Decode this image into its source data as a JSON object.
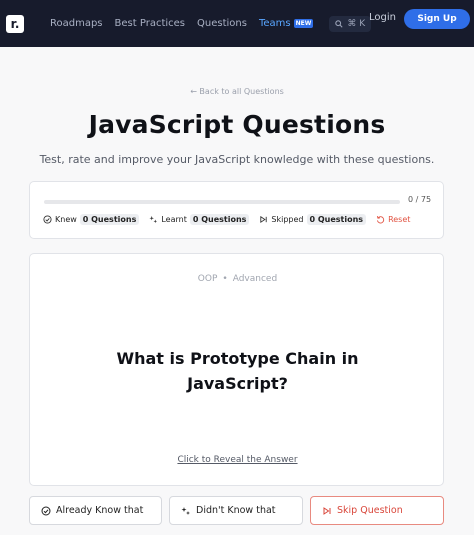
{
  "nav": {
    "logo_letter": "r.",
    "links": [
      "Roadmaps",
      "Best Practices",
      "Questions"
    ],
    "teams_label": "Teams",
    "teams_badge": "NEW",
    "search_shortcut": "⌘ K",
    "login_label": "Login",
    "signup_label": "Sign Up",
    "accent_color": "#2f6ee8"
  },
  "main": {
    "back_link": "← Back to all Questions",
    "title": "JavaScript Questions",
    "subtitle": "Test, rate and improve your JavaScript knowledge with these questions."
  },
  "progress": {
    "fraction": 0,
    "count_text": "0 / 75",
    "knew_label": "Knew",
    "knew_count": "0 Questions",
    "learnt_label": "Learnt",
    "learnt_count": "0 Questions",
    "skipped_label": "Skipped",
    "skipped_count": "0 Questions",
    "reset_label": "Reset"
  },
  "question": {
    "category": "OOP",
    "level": "Advanced",
    "separator": "•",
    "text": "What is Prototype Chain in JavaScript?",
    "reveal_label": "Click to Reveal the Answer"
  },
  "actions": {
    "know_label": "Already Know that",
    "didnt_label": "Didn't Know that",
    "skip_label": "Skip Question"
  },
  "icons": {
    "logo": "roadmap-logo-icon",
    "search": "search-icon",
    "knew": "check-circle-icon",
    "learnt": "sparkles-icon",
    "skipped": "skip-forward-icon",
    "reset": "rotate-ccw-icon"
  }
}
